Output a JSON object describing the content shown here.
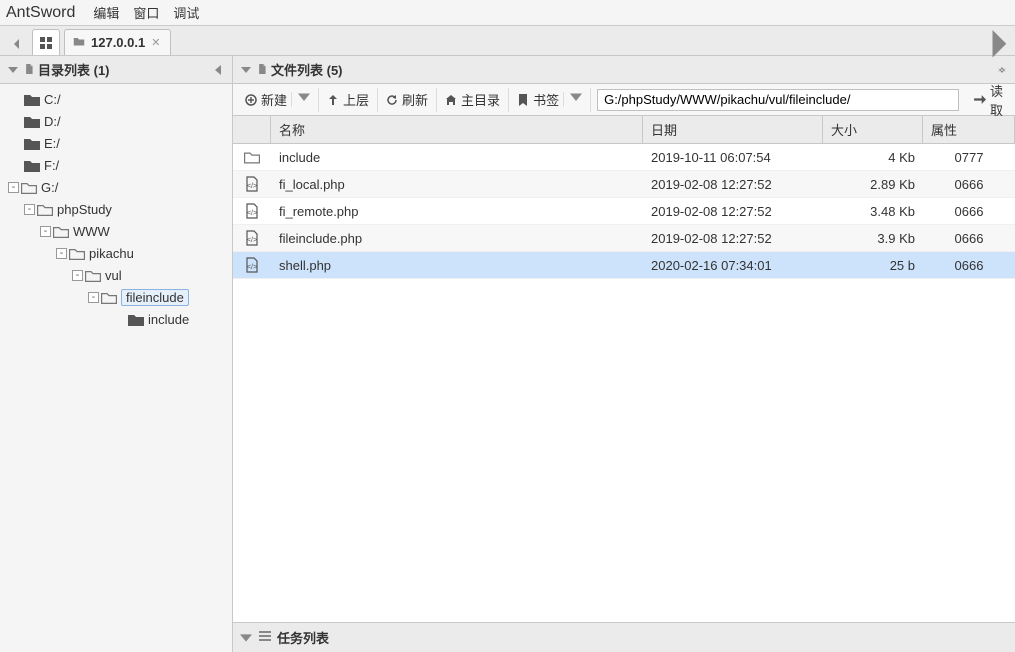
{
  "app_name": "AntSword",
  "menu": {
    "edit": "编辑",
    "window": "窗口",
    "debug": "调试"
  },
  "tabs": [
    {
      "label": "127.0.0.1"
    }
  ],
  "sidebar": {
    "title": "目录列表 (1)",
    "drives": [
      "C:/",
      "D:/",
      "E:/",
      "F:/",
      "G:/"
    ],
    "g_tree": {
      "phpStudy": "phpStudy",
      "WWW": "WWW",
      "pikachu": "pikachu",
      "vul": "vul",
      "fileinclude": "fileinclude",
      "include": "include"
    }
  },
  "filelist": {
    "title": "文件列表 (5)",
    "toolbar": {
      "new": "新建",
      "up": "上层",
      "refresh": "刷新",
      "home": "主目录",
      "bookmark": "书签",
      "read": "读取"
    },
    "path": "G:/phpStudy/WWW/pikachu/vul/fileinclude/",
    "columns": {
      "name": "名称",
      "date": "日期",
      "size": "大小",
      "attr": "属性"
    },
    "rows": [
      {
        "type": "dir",
        "name": "include",
        "date": "2019-10-11 06:07:54",
        "size": "4 Kb",
        "attr": "0777"
      },
      {
        "type": "php",
        "name": "fi_local.php",
        "date": "2019-02-08 12:27:52",
        "size": "2.89 Kb",
        "attr": "0666"
      },
      {
        "type": "php",
        "name": "fi_remote.php",
        "date": "2019-02-08 12:27:52",
        "size": "3.48 Kb",
        "attr": "0666"
      },
      {
        "type": "php",
        "name": "fileinclude.php",
        "date": "2019-02-08 12:27:52",
        "size": "3.9 Kb",
        "attr": "0666"
      },
      {
        "type": "php",
        "name": "shell.php",
        "date": "2020-02-16 07:34:01",
        "size": "25 b",
        "attr": "0666",
        "selected": true
      }
    ]
  },
  "tasks": {
    "title": "任务列表"
  }
}
